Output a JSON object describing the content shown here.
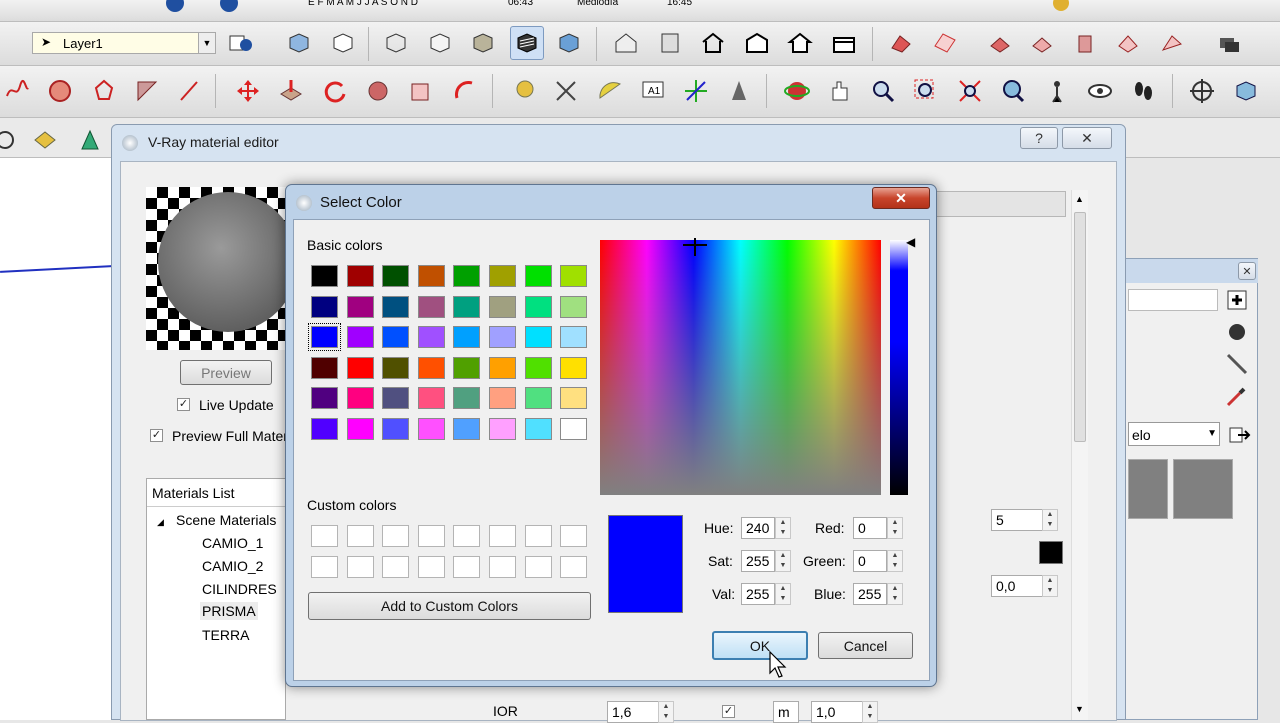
{
  "top_strip": {
    "months": "E F M A M J J A S O N D",
    "time1": "06:43",
    "noon": "Mediodía",
    "time2": "16:45"
  },
  "layer": {
    "value": "Layer1"
  },
  "vray": {
    "title": "V-Ray material editor",
    "help": "?",
    "close": "✕",
    "preview_button": "Preview",
    "live_update": "Live Update",
    "preview_full": "Preview Full Mater"
  },
  "materials": {
    "header": "Materials List",
    "root": "Scene Materials",
    "items": [
      "CAMIO_1",
      "CAMIO_2",
      "CILINDRES",
      "PRISMA",
      "TERRA"
    ]
  },
  "bottom": {
    "ior_label": "IOR",
    "ior_value": "1,6",
    "unit": "m",
    "value2": "1,0"
  },
  "right_fields": {
    "val1": "5",
    "val2": "0,0",
    "dropdown": "elo"
  },
  "dialog": {
    "title": "Select Color",
    "basic_label": "Basic colors",
    "custom_label": "Custom colors",
    "add_custom": "Add to Custom Colors",
    "hue_label": "Hue:",
    "sat_label": "Sat:",
    "val_label": "Val:",
    "red_label": "Red:",
    "green_label": "Green:",
    "blue_label": "Blue:",
    "hue": "240",
    "sat": "255",
    "val": "255",
    "red": "0",
    "green": "0",
    "blue": "255",
    "ok": "OK",
    "cancel": "Cancel",
    "preview_color": "#0000ff",
    "selected_basic_index": 16,
    "basic_colors": [
      "#000000",
      "#a00000",
      "#005000",
      "#c05000",
      "#00a000",
      "#a0a000",
      "#00e000",
      "#a0e000",
      "#000080",
      "#a00080",
      "#005080",
      "#a05080",
      "#00a080",
      "#a0a080",
      "#00e080",
      "#a0e080",
      "#0000ff",
      "#a000ff",
      "#0050ff",
      "#a050ff",
      "#00a0ff",
      "#a0a0ff",
      "#00e0ff",
      "#a0e0ff",
      "#500000",
      "#ff0000",
      "#505000",
      "#ff5000",
      "#50a000",
      "#ffa000",
      "#50e000",
      "#ffe000",
      "#500080",
      "#ff0080",
      "#505080",
      "#ff5080",
      "#50a080",
      "#ffa080",
      "#50e080",
      "#ffe080",
      "#5000ff",
      "#ff00ff",
      "#5050ff",
      "#ff50ff",
      "#50a0ff",
      "#ffa0ff",
      "#50e0ff",
      "#ffffff"
    ]
  },
  "colors": {
    "titlebar": "#bcd1e8",
    "accent_blue": "#0000ff",
    "close_red": "#c8452c"
  }
}
